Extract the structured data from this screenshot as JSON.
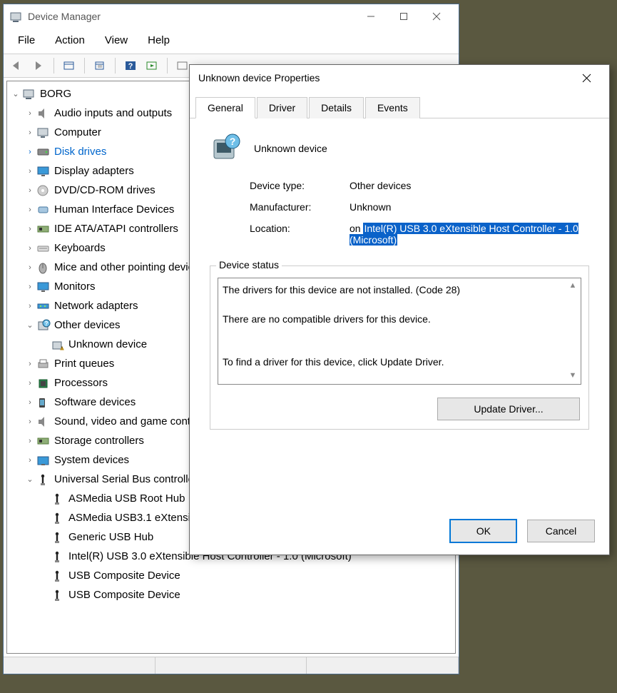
{
  "dm": {
    "title": "Device Manager",
    "menu": [
      "File",
      "Action",
      "View",
      "Help"
    ],
    "root": "BORG",
    "nodes": [
      {
        "label": "Audio inputs and outputs",
        "ex": "›",
        "icon": "audio"
      },
      {
        "label": "Computer",
        "ex": "›",
        "icon": "computer"
      },
      {
        "label": "Disk drives",
        "ex": "›",
        "icon": "disk",
        "blue": true
      },
      {
        "label": "Display adapters",
        "ex": "›",
        "icon": "display"
      },
      {
        "label": "DVD/CD-ROM drives",
        "ex": "›",
        "icon": "dvd"
      },
      {
        "label": "Human Interface Devices",
        "ex": "›",
        "icon": "hid"
      },
      {
        "label": "IDE ATA/ATAPI controllers",
        "ex": "›",
        "icon": "ide"
      },
      {
        "label": "Keyboards",
        "ex": "›",
        "icon": "kbd"
      },
      {
        "label": "Mice and other pointing devices",
        "ex": "›",
        "icon": "mouse"
      },
      {
        "label": "Monitors",
        "ex": "›",
        "icon": "monitor"
      },
      {
        "label": "Network adapters",
        "ex": "›",
        "icon": "net"
      },
      {
        "label": "Other devices",
        "ex": "⌄",
        "icon": "other"
      },
      {
        "label": "Print queues",
        "ex": "›",
        "icon": "print"
      },
      {
        "label": "Processors",
        "ex": "›",
        "icon": "cpu"
      },
      {
        "label": "Software devices",
        "ex": "›",
        "icon": "soft"
      },
      {
        "label": "Sound, video and game controllers",
        "ex": "›",
        "icon": "sound"
      },
      {
        "label": "Storage controllers",
        "ex": "›",
        "icon": "storage"
      },
      {
        "label": "System devices",
        "ex": "›",
        "icon": "sys"
      },
      {
        "label": "Universal Serial Bus controllers",
        "ex": "⌄",
        "icon": "usbctl"
      }
    ],
    "other_child": "Unknown device",
    "usb_children": [
      "ASMedia USB Root Hub",
      "ASMedia USB3.1 eXtensible Host Controller",
      "Generic USB Hub",
      "Intel(R) USB 3.0 eXtensible Host Controller - 1.0 (Microsoft)",
      "USB Composite Device",
      "USB Composite Device"
    ]
  },
  "props": {
    "title": "Unknown device Properties",
    "tabs": [
      "General",
      "Driver",
      "Details",
      "Events"
    ],
    "active_tab": 0,
    "device_name": "Unknown device",
    "rows": {
      "type_label": "Device type:",
      "type_val": "Other devices",
      "mfg_label": "Manufacturer:",
      "mfg_val": "Unknown",
      "loc_label": "Location:",
      "loc_prefix": "on ",
      "loc_hilite": "Intel(R) USB 3.0 eXtensible Host Controller - 1.0 (Microsoft)"
    },
    "status_legend": "Device status",
    "status_lines": [
      "The drivers for this device are not installed. (Code 28)",
      "",
      "There are no compatible drivers for this device.",
      "",
      "",
      "To find a driver for this device, click Update Driver."
    ],
    "update_btn": "Update Driver...",
    "ok": "OK",
    "cancel": "Cancel"
  }
}
